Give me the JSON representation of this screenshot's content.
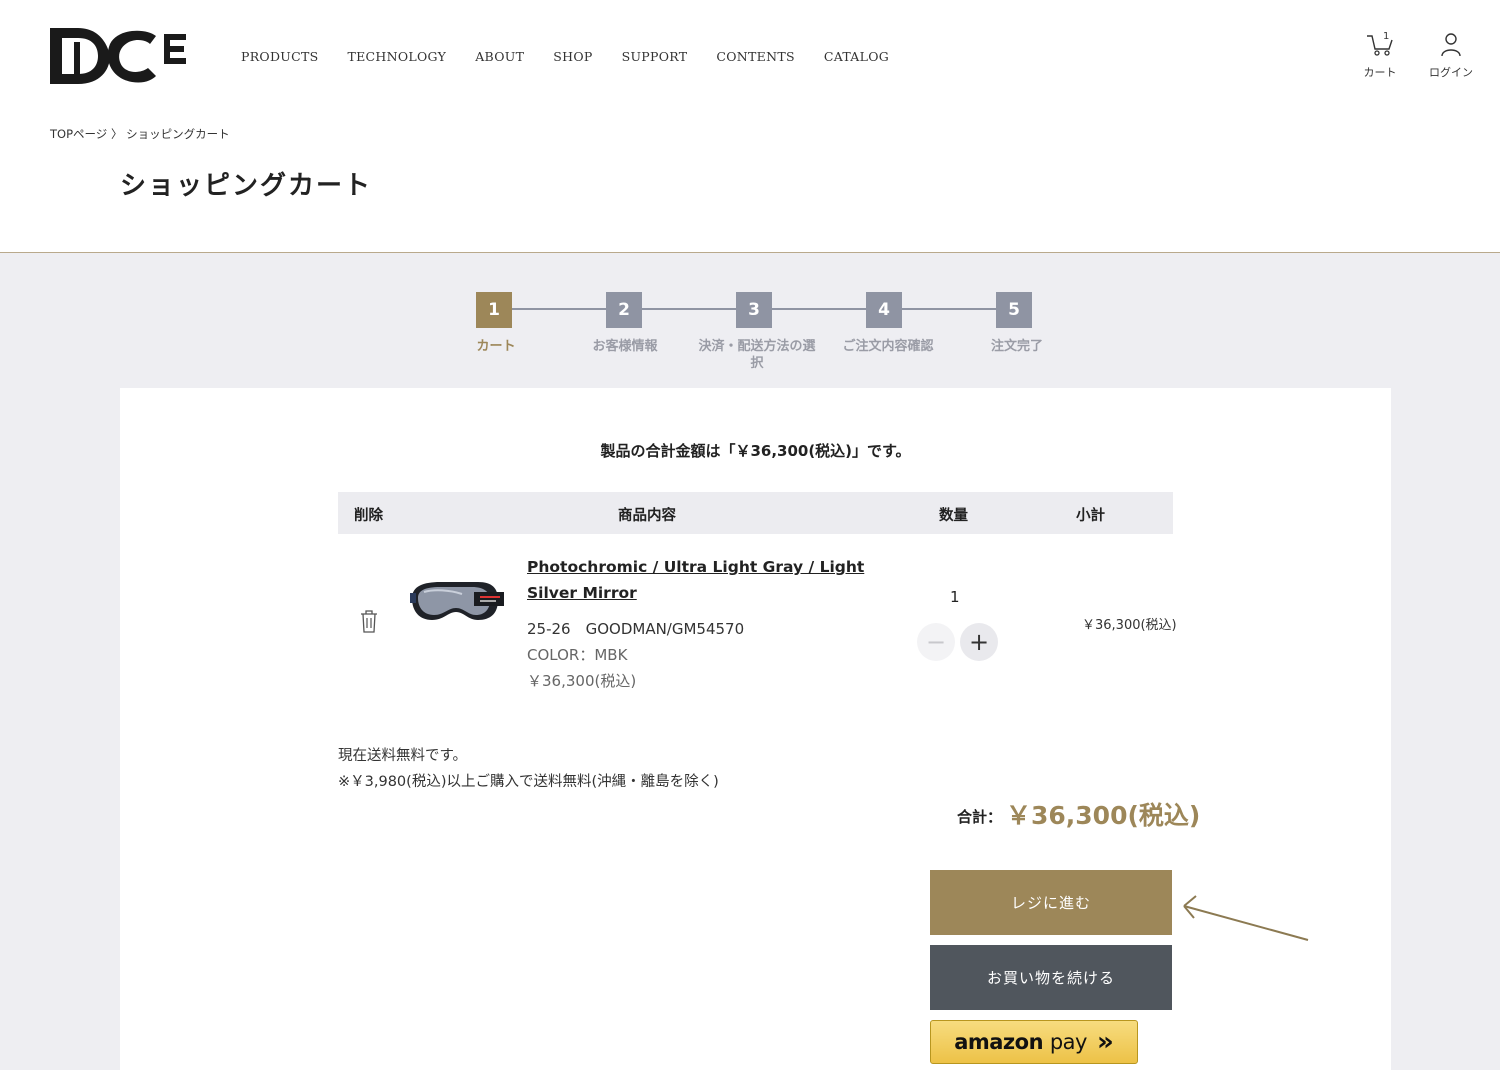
{
  "header": {
    "logo_text": "DICE",
    "nav": [
      "PRODUCTS",
      "TECHNOLOGY",
      "ABOUT",
      "SHOP",
      "SUPPORT",
      "CONTENTS",
      "CATALOG"
    ],
    "cart_label": "カート",
    "cart_count": "1",
    "login_label": "ログイン"
  },
  "breadcrumb": {
    "home": "TOPページ",
    "separator": "〉",
    "current": "ショッピングカート"
  },
  "page_title": "ショッピングカート",
  "steps": [
    {
      "num": "1",
      "label": "カート",
      "active": true
    },
    {
      "num": "2",
      "label": "お客様情報",
      "active": false
    },
    {
      "num": "3",
      "label": "決済・配送方法の選択",
      "active": false
    },
    {
      "num": "4",
      "label": "ご注文内容確認",
      "active": false
    },
    {
      "num": "5",
      "label": "注文完了",
      "active": false
    }
  ],
  "total_message": "製品の合計金額は「￥36,300(税込)」です。",
  "table": {
    "headers": [
      "削除",
      "商品内容",
      "数量",
      "小計"
    ]
  },
  "item": {
    "name": "Photochromic / Ultra Light Gray / Light Silver Mirror",
    "model": "25-26　GOODMAN/GM54570",
    "color": "COLOR：MBK",
    "price": "￥36,300(税込)",
    "quantity": "1",
    "subtotal": "￥36,300(税込)",
    "minus": "−",
    "plus": "+"
  },
  "shipping": {
    "line1": "現在送料無料です。",
    "line2": "※￥3,980(税込)以上ご購入で送料無料(沖縄・離島を除く)"
  },
  "summary": {
    "label": "合計：",
    "value": "￥36,300(税込)"
  },
  "buttons": {
    "checkout": "レジに進む",
    "continue": "お買い物を続ける",
    "amazon_brand": "amazon",
    "amazon_pay": "pay",
    "amazon_chevron": "»"
  },
  "colors": {
    "accent": "#9d8759",
    "step_inactive": "#8f94a3",
    "continue_btn": "#50565d",
    "background_gray": "#eeeef2"
  }
}
